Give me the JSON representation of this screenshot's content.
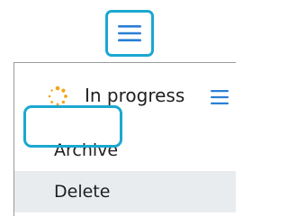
{
  "status": {
    "label": "In progress",
    "icon": "spinner-icon",
    "menu_icon": "hamburger-icon"
  },
  "top_button": {
    "icon": "hamburger-icon"
  },
  "menu": {
    "items": [
      {
        "label": "Archive"
      },
      {
        "label": "Delete"
      }
    ]
  },
  "colors": {
    "highlight": "#1aa8cf",
    "menu_icon_blue": "#2a7fd4",
    "spinner": "#f2a516",
    "selected_row": "#e8ecef"
  }
}
